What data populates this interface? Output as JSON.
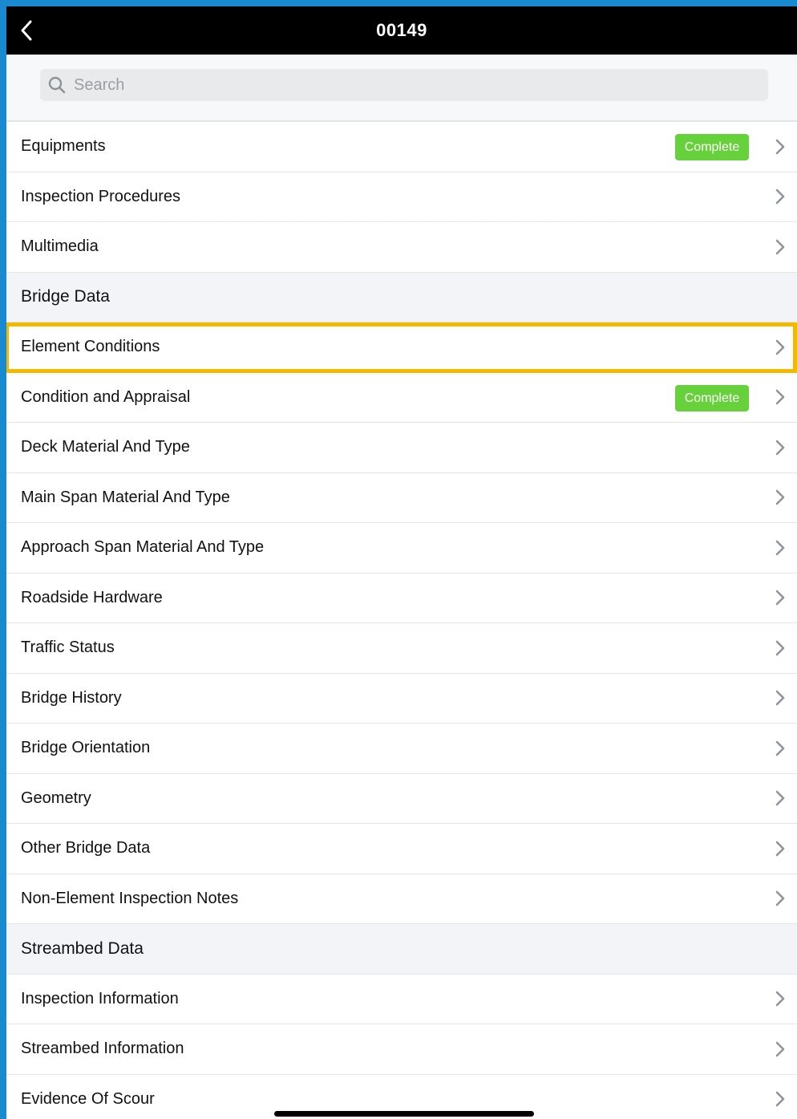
{
  "navbar": {
    "title": "00149"
  },
  "search": {
    "placeholder": "Search"
  },
  "items": [
    {
      "type": "row",
      "label": "Equipments",
      "badge": "Complete"
    },
    {
      "type": "row",
      "label": "Inspection Procedures"
    },
    {
      "type": "row",
      "label": "Multimedia"
    },
    {
      "type": "section",
      "label": "Bridge Data"
    },
    {
      "type": "row",
      "label": "Element Conditions",
      "highlighted": true
    },
    {
      "type": "row",
      "label": "Condition and Appraisal",
      "badge": "Complete"
    },
    {
      "type": "row",
      "label": "Deck Material And Type"
    },
    {
      "type": "row",
      "label": "Main Span Material And Type"
    },
    {
      "type": "row",
      "label": "Approach Span Material And Type"
    },
    {
      "type": "row",
      "label": "Roadside Hardware"
    },
    {
      "type": "row",
      "label": "Traffic Status"
    },
    {
      "type": "row",
      "label": "Bridge History"
    },
    {
      "type": "row",
      "label": "Bridge Orientation"
    },
    {
      "type": "row",
      "label": "Geometry"
    },
    {
      "type": "row",
      "label": "Other Bridge Data"
    },
    {
      "type": "row",
      "label": "Non-Element Inspection Notes"
    },
    {
      "type": "section",
      "label": "Streambed Data"
    },
    {
      "type": "row",
      "label": "Inspection Information"
    },
    {
      "type": "row",
      "label": "Streambed Information"
    },
    {
      "type": "row",
      "label": "Evidence Of Scour"
    }
  ],
  "colors": {
    "background_accent": "#1a8ad0",
    "navbar": "#000000",
    "badge_complete": "#66d13a",
    "highlight": "#f5b800"
  }
}
